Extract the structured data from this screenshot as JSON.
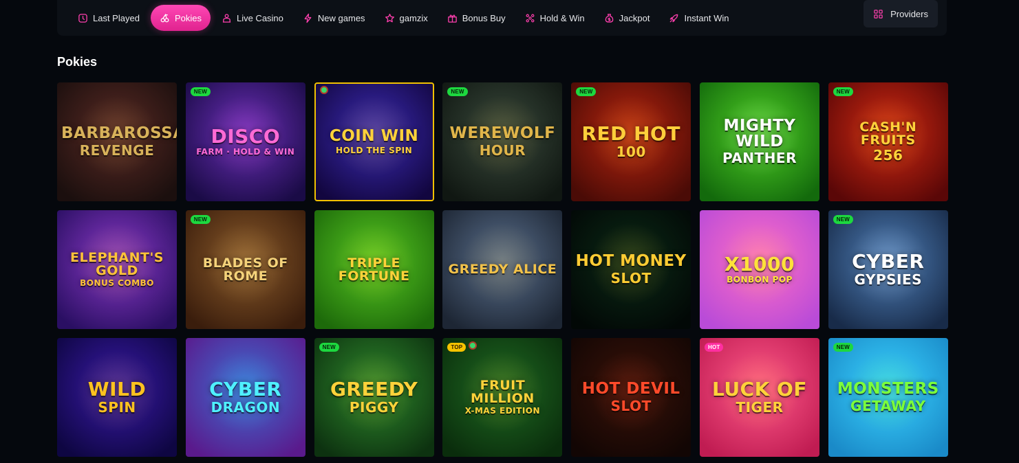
{
  "nav": {
    "items": [
      {
        "label": "Last Played",
        "icon": "clock-icon",
        "name": "nav-last-played"
      },
      {
        "label": "Pokies",
        "icon": "cherries-icon",
        "name": "nav-pokies",
        "active": true
      },
      {
        "label": "Live Casino",
        "icon": "dealer-icon",
        "name": "nav-live-casino"
      },
      {
        "label": "New games",
        "icon": "lightning-icon",
        "name": "nav-new-games"
      },
      {
        "label": "gamzix",
        "icon": "star-icon",
        "name": "nav-gamzix"
      },
      {
        "label": "Bonus Buy",
        "icon": "gift-icon",
        "name": "nav-bonus-buy"
      },
      {
        "label": "Hold & Win",
        "icon": "dots-grid-icon",
        "name": "nav-hold-win"
      },
      {
        "label": "Jackpot",
        "icon": "money-bag-icon",
        "name": "nav-jackpot"
      },
      {
        "label": "Instant Win",
        "icon": "rocket-icon",
        "name": "nav-instant-win"
      }
    ],
    "providers_label": "Providers"
  },
  "section": {
    "title": "Pokies"
  },
  "games": [
    {
      "title": "Barbarossa",
      "subtitle": "Revenge",
      "badge": "",
      "bg": "#5a2a24",
      "bg2": "#1b0f0e",
      "text": "#d8b25a"
    },
    {
      "title": "Disco",
      "subtitle": "Farm · Hold & Win",
      "badge": "NEW",
      "bg": "#6b2fb8",
      "bg2": "#1a0b46",
      "text": "#ff6ad5"
    },
    {
      "title": "Coin Win",
      "subtitle": "Hold the Spin",
      "badge": "",
      "bg": "#3b2bb3",
      "bg2": "#12063f",
      "text": "#ffd23a",
      "selected": true,
      "pin": true
    },
    {
      "title": "Werewolf",
      "subtitle": "Hour",
      "badge": "NEW",
      "bg": "#3a4a3c",
      "bg2": "#101712",
      "text": "#e0b54a"
    },
    {
      "title": "Red Hot",
      "subtitle": "100",
      "badge": "NEW",
      "bg": "#b8250f",
      "bg2": "#4a0b06",
      "text": "#ffcf3b"
    },
    {
      "title": "Mighty Wild",
      "subtitle": "Panther",
      "badge": "",
      "bg": "#4fcf25",
      "bg2": "#136a0c",
      "text": "#ffffff"
    },
    {
      "title": "Cash'n Fruits",
      "subtitle": "256",
      "badge": "NEW",
      "bg": "#d22a12",
      "bg2": "#5a0707",
      "text": "#ffd23a"
    },
    {
      "title": "Elephant's Gold",
      "subtitle": "Bonus Combo",
      "badge": "",
      "bg": "#8a39c6",
      "bg2": "#2a0f63",
      "text": "#ffc338"
    },
    {
      "title": "Blades of Rome",
      "subtitle": "",
      "badge": "NEW",
      "bg": "#8a5a2a",
      "bg2": "#3a1d0c",
      "text": "#f4d27a"
    },
    {
      "title": "Triple Fortune",
      "subtitle": "",
      "badge": "",
      "bg": "#58c822",
      "bg2": "#1d6a0a",
      "text": "#ffd23a"
    },
    {
      "title": "Greedy Alice",
      "subtitle": "",
      "badge": "",
      "bg": "#5a6f8c",
      "bg2": "#1d2634",
      "text": "#f2c24a"
    },
    {
      "title": "Hot Money",
      "subtitle": "Slot",
      "badge": "",
      "bg": "#0b2a16",
      "bg2": "#020806",
      "text": "#ffcc33"
    },
    {
      "title": "x1000",
      "subtitle": "Bonbon Pop",
      "badge": "",
      "bg": "#ff6ec4",
      "bg2": "#b94bd8",
      "text": "#ffe23a"
    },
    {
      "title": "Cyber",
      "subtitle": "Gypsies",
      "badge": "NEW",
      "bg": "#4f7fb8",
      "bg2": "#182b49",
      "text": "#ffffff"
    },
    {
      "title": "Wild",
      "subtitle": "Spin",
      "badge": "",
      "bg": "#3a1aa8",
      "bg2": "#0e0642",
      "text": "#ffc21f"
    },
    {
      "title": "Cyber",
      "subtitle": "Dragon",
      "badge": "",
      "bg": "#3c6fd3",
      "bg2": "#5a1a8c",
      "text": "#4ff0ff"
    },
    {
      "title": "Greedy",
      "subtitle": "Piggy",
      "badge": "NEW",
      "bg": "#2f8a2c",
      "bg2": "#0d3210",
      "text": "#ffd23a"
    },
    {
      "title": "Fruit Million",
      "subtitle": "X-mas Edition",
      "badge": "TOP",
      "bg": "#1f6a22",
      "bg2": "#0a2d0c",
      "text": "#ffd23a",
      "pin": true
    },
    {
      "title": "Hot Devil",
      "subtitle": "Slot",
      "badge": "",
      "bg": "#3a1208",
      "bg2": "#120604",
      "text": "#ff4a2a"
    },
    {
      "title": "Luck of",
      "subtitle": "Tiger",
      "badge": "HOT",
      "bg": "#ff5a8a",
      "bg2": "#c01c52",
      "text": "#ffd23a"
    },
    {
      "title": "Monsters",
      "subtitle": "Getaway",
      "badge": "NEW",
      "bg": "#3ad3ff",
      "bg2": "#1a8ac8",
      "text": "#7cff3a"
    }
  ]
}
